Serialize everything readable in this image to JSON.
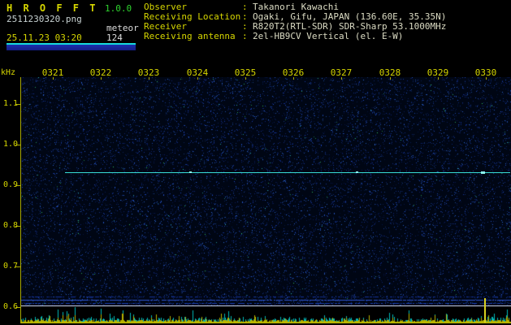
{
  "header": {
    "app_title": "H R O F F T",
    "version": "1.0.0",
    "filename": "2511230320.png",
    "mode": "meteor",
    "datetime": "25.11.23 03:20",
    "count": "124",
    "info": {
      "separator": ":",
      "rows": [
        {
          "label": "Observer",
          "value": "Takanori Kawachi"
        },
        {
          "label": "Receiving Location",
          "value": "Ogaki, Gifu, JAPAN (136.60E, 35.35N)"
        },
        {
          "label": "Receiver",
          "value": "R820T2(RTL-SDR) SDR-Sharp 53.1000MHz"
        },
        {
          "label": "Receiving antenna",
          "value": "2el-HB9CV Vertical (el. E-W)"
        }
      ]
    }
  },
  "plot": {
    "freq_unit_label": "kHz",
    "time_labels": [
      "0321",
      "0322",
      "0323",
      "0324",
      "0325",
      "0326",
      "0327",
      "0328",
      "0329",
      "0330"
    ],
    "freq_labels": [
      "1.1",
      "1.0",
      "0.9",
      "0.8",
      "0.7",
      "0.6"
    ]
  },
  "chart_data": {
    "type": "heatmap",
    "description": "Radio meteor observation spectrogram: dark blue noise background, continuous carrier line, and a signal-amplitude bar strip along the bottom edge",
    "x_tick_labels": [
      "0321",
      "0322",
      "0323",
      "0324",
      "0325",
      "0326",
      "0327",
      "0328",
      "0329",
      "0330"
    ],
    "y_tick_labels": [
      "1.1",
      "1.0",
      "0.9",
      "0.8",
      "0.7",
      "0.6"
    ],
    "ylabel": "kHz",
    "ylim": [
      0.58,
      1.17
    ],
    "grid": false,
    "legend": false,
    "series": [
      {
        "name": "carrier-line",
        "type": "line",
        "y_khz": 0.93,
        "x_start": "0321",
        "x_end": "0330",
        "color": "#38dcd4"
      }
    ],
    "events": [
      {
        "x": "0330",
        "type": "amplitude-spike",
        "color": "#d8d020"
      }
    ]
  },
  "colors": {
    "label_yellow": "#d6d600",
    "value_white": "#dcdcc4",
    "version_green": "#2ed42e",
    "signal_cyan": "#38dcd4",
    "noise_blue": "#1a3fb2",
    "strip_yellow": "#b9b400",
    "strip_cyan": "#00b9b9",
    "background": "#000000"
  }
}
